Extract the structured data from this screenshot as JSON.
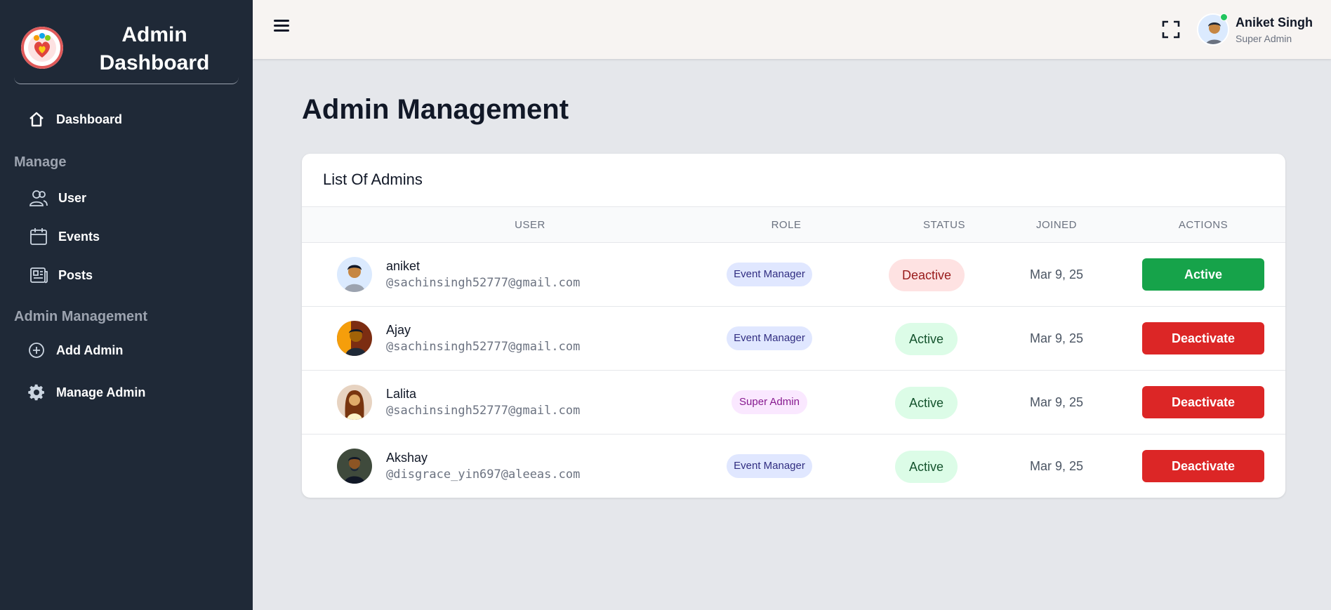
{
  "sidebar": {
    "brand_title": "Admin Dashboard",
    "dashboard_label": "Dashboard",
    "manage_label": "Manage",
    "items_manage": [
      {
        "label": "User",
        "icon": "users-icon"
      },
      {
        "label": "Events",
        "icon": "calendar-icon"
      },
      {
        "label": "Posts",
        "icon": "newspaper-icon"
      }
    ],
    "admin_mgmt_label": "Admin Management",
    "items_admin": [
      {
        "label": "Add Admin",
        "icon": "plus-circle-icon"
      },
      {
        "label": "Manage Admin",
        "icon": "gear-icon"
      }
    ]
  },
  "topbar": {
    "profile_name": "Aniket Singh",
    "profile_role": "Super Admin"
  },
  "main": {
    "page_title": "Admin Management",
    "card_title": "List Of Admins",
    "columns": [
      "USER",
      "ROLE",
      "STATUS",
      "JOINED",
      "ACTIONS"
    ],
    "rows": [
      {
        "name": "aniket",
        "email": "@sachinsingh52777@gmail.com",
        "role": "Event Manager",
        "status": "Deactive",
        "joined": "Mar 9, 25",
        "action": "Active"
      },
      {
        "name": "Ajay",
        "email": "@sachinsingh52777@gmail.com",
        "role": "Event Manager",
        "status": "Active",
        "joined": "Mar 9, 25",
        "action": "Deactivate"
      },
      {
        "name": "Lalita",
        "email": "@sachinsingh52777@gmail.com",
        "role": "Super Admin",
        "status": "Active",
        "joined": "Mar 9, 25",
        "action": "Deactivate"
      },
      {
        "name": "Akshay",
        "email": "@disgrace_yin697@aleeas.com",
        "role": "Event Manager",
        "status": "Active",
        "joined": "Mar 9, 25",
        "action": "Deactivate"
      }
    ]
  },
  "colors": {
    "sidebar_bg": "#1f2937",
    "active_green": "#16a34a",
    "deactivate_red": "#dc2626"
  }
}
